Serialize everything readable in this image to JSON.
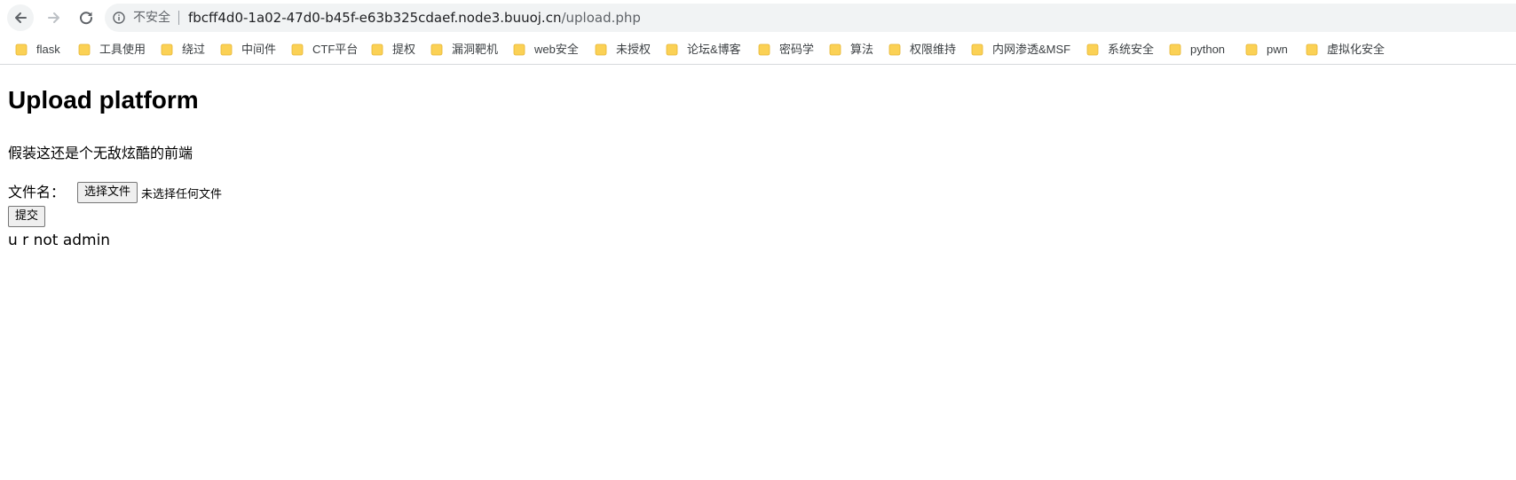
{
  "browser": {
    "security_label": "不安全",
    "url_host": "fbcff4d0-1a02-47d0-b45f-e63b325cdaef.node3.buuoj.cn",
    "url_path": "/upload.php",
    "folder_color": "#fbd155"
  },
  "bookmarks": [
    {
      "label": "flask"
    },
    {
      "label": "工具使用"
    },
    {
      "label": "绕过"
    },
    {
      "label": "中间件"
    },
    {
      "label": "CTF平台"
    },
    {
      "label": "提权"
    },
    {
      "label": "漏洞靶机"
    },
    {
      "label": "web安全"
    },
    {
      "label": "未授权"
    },
    {
      "label": "论坛&博客"
    },
    {
      "label": "密码学"
    },
    {
      "label": "算法"
    },
    {
      "label": "权限维持"
    },
    {
      "label": "内网渗透&MSF"
    },
    {
      "label": "系统安全"
    },
    {
      "label": "python"
    },
    {
      "label": "pwn"
    },
    {
      "label": "虚拟化安全"
    }
  ],
  "page": {
    "title": "Upload platform",
    "subtitle": "假装这还是个无敌炫酷的前端",
    "file_label": "文件名：",
    "choose_file_button": "选择文件",
    "no_file_text": "未选择任何文件",
    "submit_button": "提交",
    "result_message": "u r not admin"
  }
}
